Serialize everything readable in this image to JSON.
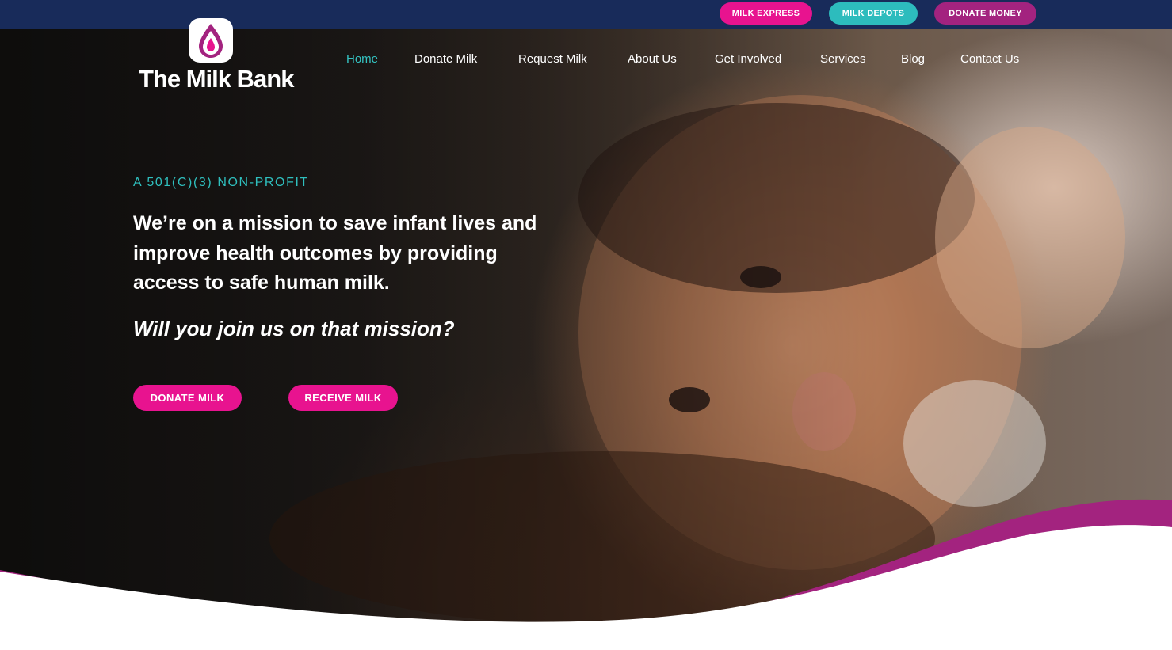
{
  "topbar": {
    "milk_express": "MILK EXPRESS",
    "milk_depots": "MILK DEPOTS",
    "donate_money": "DONATE MONEY"
  },
  "logo": {
    "text": "The Milk Bank"
  },
  "nav": {
    "items": [
      {
        "label": "Home",
        "active": true
      },
      {
        "label": "Donate Milk"
      },
      {
        "label": "Request Milk"
      },
      {
        "label": "About Us"
      },
      {
        "label": "Get Involved"
      },
      {
        "label": "Services"
      },
      {
        "label": "Blog"
      },
      {
        "label": "Contact Us"
      }
    ]
  },
  "hero": {
    "eyebrow": "A 501(C)(3) NON-PROFIT",
    "headline_line1": "We’re on a mission to save infant lives and",
    "headline_line2": "improve health outcomes by providing",
    "headline_line3": "access to safe human milk.",
    "subline": "Will you join us on that mission?",
    "cta_donate": "DONATE MILK",
    "cta_receive": "RECEIVE MILK"
  },
  "colors": {
    "navy": "#182b5a",
    "pink": "#e8138f",
    "teal": "#2dbcbd",
    "purple": "#a3237f"
  }
}
